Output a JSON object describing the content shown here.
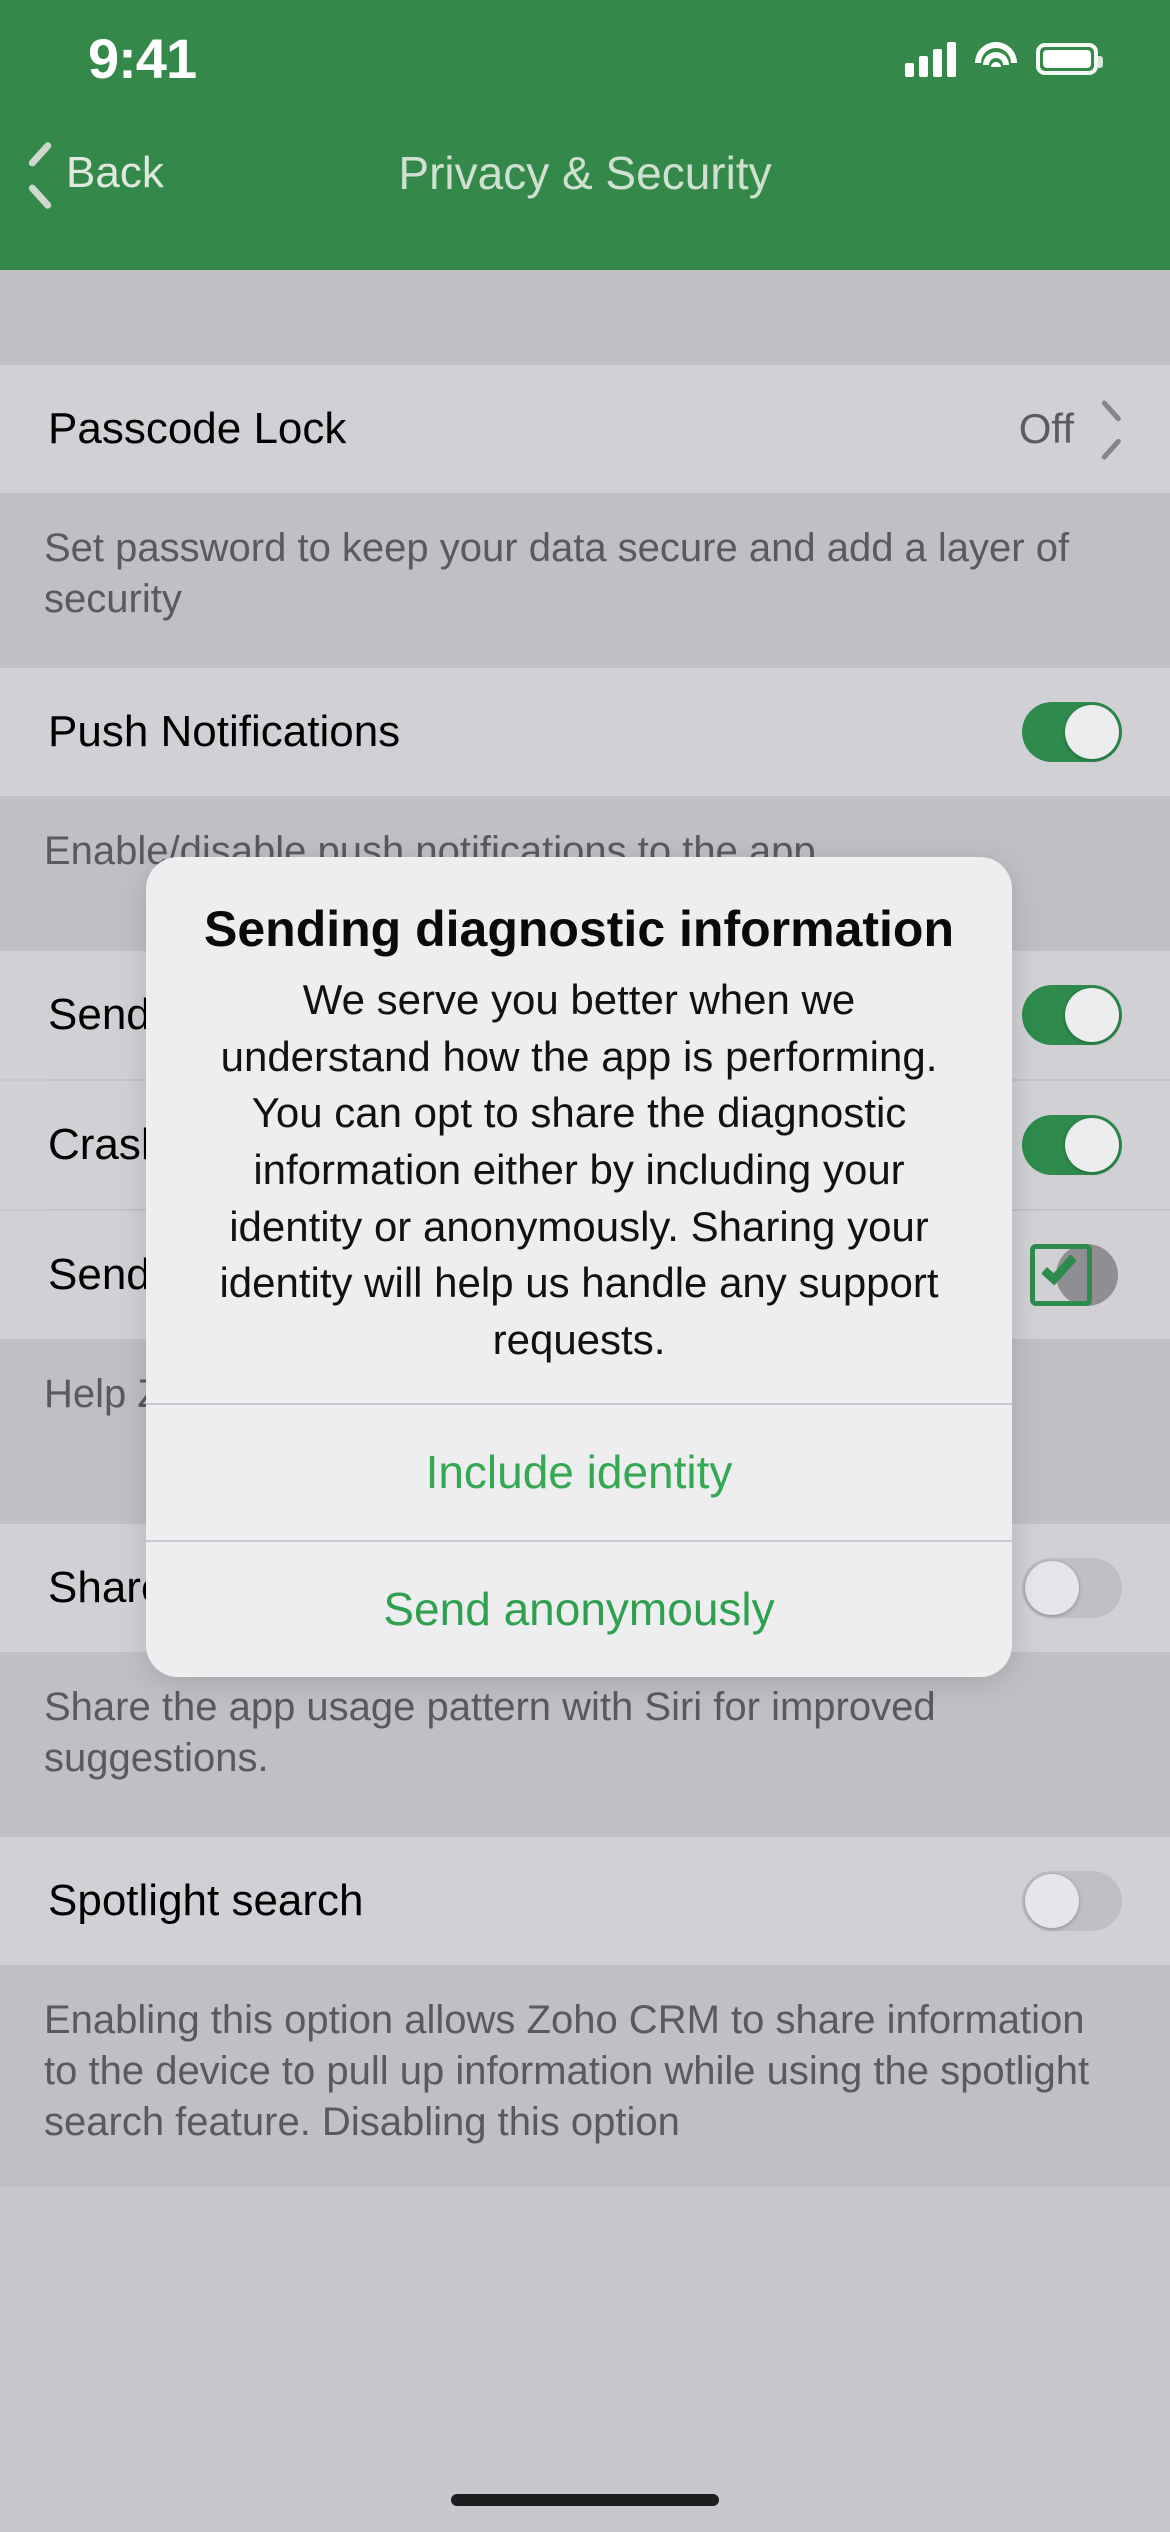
{
  "statusbar": {
    "time": "9:41",
    "cellular_icon": "cellular-bars-icon",
    "wifi_icon": "wifi-icon",
    "battery_icon": "battery-full-icon"
  },
  "navbar": {
    "back_label": "Back",
    "back_icon": "chevron-left-icon",
    "title": "Privacy & Security"
  },
  "colors": {
    "header_green": "#34894a",
    "accent_green": "#2e8b4d",
    "action_green": "#34a853",
    "list_row": "#d1d1d5",
    "list_gap": "#c0c0c4",
    "dialog_bg": "#eeeef0"
  },
  "settings": {
    "sections": [
      {
        "rows": [
          {
            "label": "Passcode Lock",
            "value": "Off",
            "control": "disclosure",
            "chevron_icon": "chevron-right-icon"
          }
        ],
        "footnote": "Set password to keep your data secure and add a layer of security"
      },
      {
        "rows": [
          {
            "label": "Push Notifications",
            "control": "toggle",
            "state": "on"
          }
        ],
        "footnote": "Enable/disable push notifications to the app"
      },
      {
        "rows": [
          {
            "label": "Send d",
            "control": "toggle",
            "state": "on"
          },
          {
            "label": "Crash",
            "control": "toggle",
            "state": "on"
          },
          {
            "label": "Send a",
            "control": "checkbox",
            "state": "checked",
            "checkbox_icon": "checkmark-box-icon"
          }
        ],
        "footnote": "Help Zoho automatically statistics"
      },
      {
        "rows": [
          {
            "label": "Share user activities",
            "control": "toggle",
            "state": "off"
          }
        ],
        "footnote": "Share the app usage pattern with Siri for improved suggestions."
      },
      {
        "rows": [
          {
            "label": "Spotlight search",
            "control": "toggle",
            "state": "off"
          }
        ],
        "footnote": "Enabling this option allows Zoho CRM to share information to the device to pull up information while using the spotlight search feature. Disabling this option"
      }
    ]
  },
  "dialog": {
    "title": "Sending diagnostic information",
    "message": "We serve you better when we understand how the app is performing. You can opt to share the diagnostic information either by including your identity or anonymously. Sharing your identity will help us handle any support requests.",
    "actions": [
      {
        "label": "Include identity"
      },
      {
        "label": "Send anonymously"
      }
    ]
  }
}
